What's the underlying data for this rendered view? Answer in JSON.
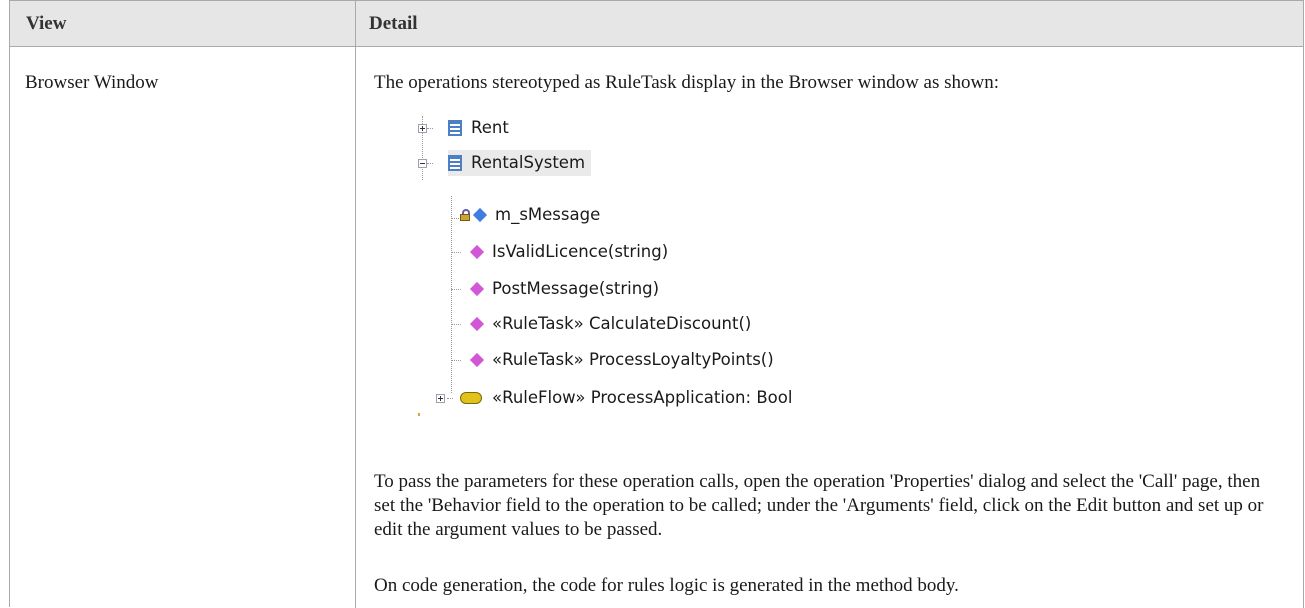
{
  "header": {
    "view": "View",
    "detail": "Detail"
  },
  "row": {
    "view": "Browser Window",
    "intro": "The operations stereotyped as RuleTask display in the Browser window as shown:",
    "tree": {
      "rent": "Rent",
      "rental_system": "RentalSystem",
      "attribute": "m_sMessage",
      "op1": "IsValidLicence(string)",
      "op2": "PostMessage(string)",
      "op3": "«RuleTask» CalculateDiscount()",
      "op4": "«RuleTask» ProcessLoyaltyPoints()",
      "ruleflow": "«RuleFlow» ProcessApplication: Bool"
    },
    "para2": "To pass the parameters for these operation calls, open the operation 'Properties' dialog and select the 'Call' page, then set the 'Behavior field to the operation to be called; under the 'Arguments' field, click on the Edit button and set up or edit the argument values to be passed.",
    "para3": "On code generation, the code for rules logic is generated in the method body."
  }
}
